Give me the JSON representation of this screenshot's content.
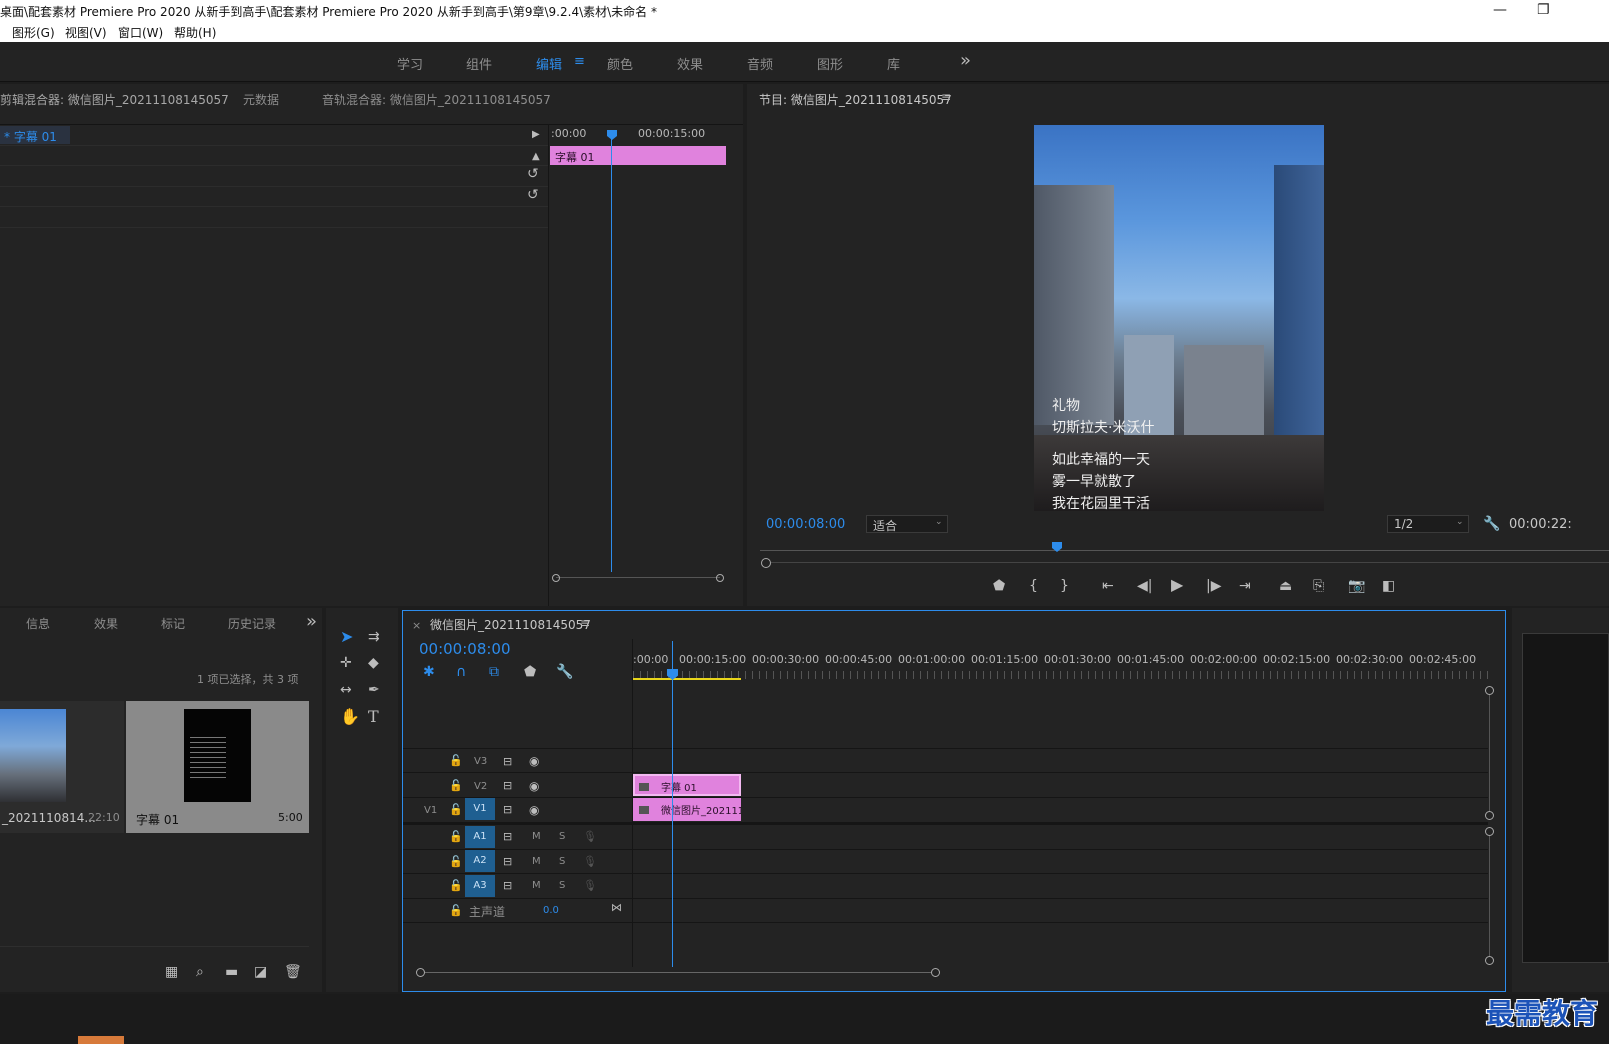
{
  "window": {
    "title": "桌面\\配套素材 Premiere Pro 2020 从新手到高手\\配套素材 Premiere Pro 2020 从新手到高手\\第9章\\9.2.4\\素材\\未命名 *",
    "minimize": "—",
    "restore": "❐"
  },
  "menu": [
    "图形(G)",
    "视图(V)",
    "窗口(W)",
    "帮助(H)"
  ],
  "workspaces": [
    "学习",
    "组件",
    "编辑",
    "颜色",
    "效果",
    "音频",
    "图形",
    "库"
  ],
  "workspace_active": "编辑",
  "workspace_menu_icon": "≡",
  "workspace_overflow": "»",
  "source_panel": {
    "tabs": [
      "剪辑混合器: 微信图片_20211108145057",
      "元数据",
      "音轨混合器: 微信图片_20211108145057"
    ],
    "effect_item": "* 字幕 01",
    "timecode_start": ":00:00",
    "timecode_mid": "00:00:15:00",
    "clip_label": "字幕 01"
  },
  "program_monitor": {
    "title": "节目: 微信图片_20211108145057",
    "menu_icon": "≡",
    "timecode": "00:00:08:00",
    "fit": "适合",
    "resolution": "1/2",
    "duration": "00:00:22:",
    "overlay_lines": [
      "礼物",
      "切斯拉夫·米沃什",
      "如此幸福的一天",
      "雾一早就散了",
      "我在花园里干活"
    ]
  },
  "project_panel": {
    "tabs": [
      "信息",
      "效果",
      "标记",
      "历史记录"
    ],
    "overflow": "»",
    "selection_info": "1 项已选择，共 3 项",
    "items": [
      {
        "name": "_2021110814...",
        "duration": "22:10"
      },
      {
        "name": "字幕 01",
        "duration": "5:00"
      }
    ]
  },
  "timeline": {
    "close": "×",
    "sequence_name": "微信图片_20211108145057",
    "menu_icon": "≡",
    "timecode": "00:00:08:00",
    "ruler": [
      ":00:00",
      "00:00:15:00",
      "00:00:30:00",
      "00:00:45:00",
      "00:01:00:00",
      "00:01:15:00",
      "00:01:30:00",
      "00:01:45:00",
      "00:02:00:00",
      "00:02:15:00",
      "00:02:30:00",
      "00:02:45:00"
    ],
    "video_tracks": [
      "V3",
      "V2",
      "V1"
    ],
    "source_patch": "V1",
    "audio_tracks": [
      "A1",
      "A2",
      "A3"
    ],
    "mute": "M",
    "solo": "S",
    "master_label": "主声道",
    "master_value": "0.0",
    "clips": {
      "v2": "字幕 01",
      "v1": "微信图片_202111"
    }
  },
  "watermark": "最需教育",
  "colors": {
    "accent": "#2d8ceb",
    "clip": "#e082dd",
    "track_button": "#1f5f91",
    "panel": "#232323"
  }
}
